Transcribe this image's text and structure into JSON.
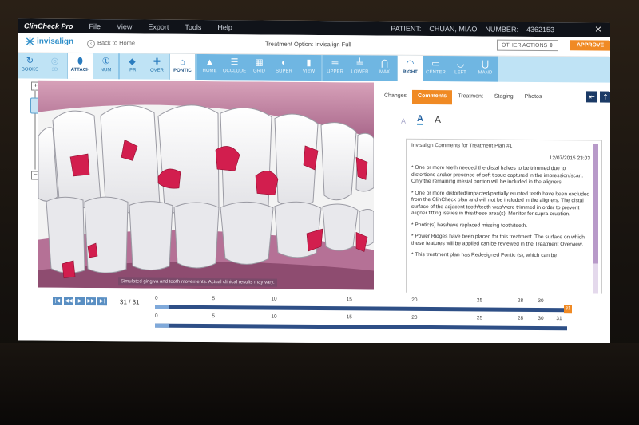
{
  "titlebar": {
    "app_title": "ClinCheck Pro",
    "menu": [
      "File",
      "View",
      "Export",
      "Tools",
      "Help"
    ],
    "patient_label": "PATIENT:",
    "patient_name": "CHUAN, MIAO",
    "number_label": "NUMBER:",
    "patient_number": "4362153",
    "close_glyph": "✕"
  },
  "header": {
    "logo_text": "invisalign",
    "back_label": "Back to Home",
    "treatment_option_label": "Treatment Option:",
    "treatment_option_value": "Invisalign Full",
    "other_actions_label": "OTHER ACTIONS ⇕",
    "approve_label": "APPROVE"
  },
  "toolbar": {
    "buttons": [
      {
        "label": "BOOKS",
        "icon": "↻"
      },
      {
        "label": "3D",
        "icon": "◎"
      },
      {
        "label": "ATTACH",
        "icon": "⬮"
      },
      {
        "label": "NUM",
        "icon": "①"
      },
      {
        "label": "IPR",
        "icon": "◆"
      },
      {
        "label": "OVER",
        "icon": "✚"
      },
      {
        "label": "PONTIC",
        "icon": "⌂"
      },
      {
        "label": "HOME",
        "icon": "▲"
      },
      {
        "label": "OCCLUDE",
        "icon": "☰"
      },
      {
        "label": "GRID",
        "icon": "▦"
      },
      {
        "label": "SUPER",
        "icon": "◐"
      },
      {
        "label": "VIEW",
        "icon": "▮"
      },
      {
        "label": "UPPER",
        "icon": "╤"
      },
      {
        "label": "LOWER",
        "icon": "╧"
      },
      {
        "label": "MAX",
        "icon": "⋂"
      },
      {
        "label": "RIGHT",
        "icon": "◠"
      },
      {
        "label": "CENTER",
        "icon": "▭"
      },
      {
        "label": "LEFT",
        "icon": "◡"
      },
      {
        "label": "MAND",
        "icon": "⋃"
      }
    ]
  },
  "panel": {
    "tabs": [
      "Changes",
      "Comments",
      "Treatment",
      "Staging",
      "Photos"
    ],
    "active_tab": "Comments",
    "tools": [
      "⇤",
      "⇡"
    ],
    "font_sizes": [
      "A",
      "A",
      "A"
    ],
    "comments_title": "Invisalign Comments for Treatment Plan #1",
    "comments_date": "12/07/2015 23:03",
    "comments": [
      "* One or more teeth needed the distal halves to be trimmed due to distortions and/or presence of soft tissue captured in the impression/scan. Only the remaining mesial portion will be included in the aligners.",
      "* One or more distorted/impacted/partially erupted teeth have been excluded from the ClinCheck plan and will not be included in the aligners. The distal surface of the adjacent tooth/teeth was/were trimmed in order to prevent aligner fitting issues in this/these area(s). Monitor for supra-eruption.",
      "* Pontic(s) has/have replaced missing tooth/teeth.",
      "* Power Ridges have been placed for this treatment. The surface on which these features will be applied can be reviewed in the Treatment Overview.",
      "* This treatment plan has Redesigned Pontic (s), which can be"
    ]
  },
  "view": {
    "disclaimer": "Simulated gingiva and tooth movements. Actual clinical results may vary."
  },
  "timeline": {
    "controls": [
      "|◀",
      "◀◀",
      "▶",
      "▶▶",
      "▶|"
    ],
    "stage_count": "31 / 31",
    "upper_numbers": [
      {
        "v": "0",
        "f": 0.0
      },
      {
        "v": "5",
        "f": 0.14
      },
      {
        "v": "10",
        "f": 0.285
      },
      {
        "v": "15",
        "f": 0.47
      },
      {
        "v": "20",
        "f": 0.63
      },
      {
        "v": "25",
        "f": 0.79
      },
      {
        "v": "28",
        "f": 0.89
      },
      {
        "v": "30",
        "f": 0.94
      }
    ],
    "lower_numbers": [
      {
        "v": "0",
        "f": 0.0
      },
      {
        "v": "5",
        "f": 0.14
      },
      {
        "v": "10",
        "f": 0.285
      },
      {
        "v": "15",
        "f": 0.47
      },
      {
        "v": "20",
        "f": 0.63
      },
      {
        "v": "25",
        "f": 0.79
      },
      {
        "v": "28",
        "f": 0.89
      },
      {
        "v": "30",
        "f": 0.94
      },
      {
        "v": "31",
        "f": 0.985
      }
    ],
    "current_stage": "31"
  },
  "accent_colors": {
    "toolbar": "#bfe3f5",
    "orange": "#f08a24",
    "navy": "#2e4f86",
    "attachment": "#d21e4e"
  }
}
